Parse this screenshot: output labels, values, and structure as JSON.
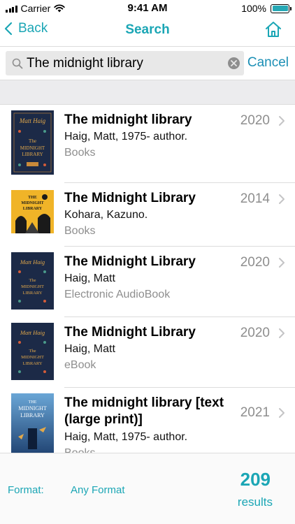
{
  "status_bar": {
    "carrier": "Carrier",
    "time": "9:41 AM",
    "battery": "100%"
  },
  "nav": {
    "back_label": "Back",
    "title": "Search"
  },
  "search": {
    "query": "The midnight library",
    "cancel_label": "Cancel"
  },
  "results": [
    {
      "title": "The midnight library",
      "author": "Haig, Matt, 1975- author.",
      "format": "Books",
      "year": "2020",
      "cover_caption": "Matt Haig"
    },
    {
      "title": "The Midnight Library",
      "author": "Kohara, Kazuno.",
      "format": "Books",
      "year": "2014",
      "cover_caption": "The Midnight Library"
    },
    {
      "title": "The Midnight Library",
      "author": "Haig, Matt",
      "format": "Electronic AudioBook",
      "year": "2020",
      "cover_caption": "Matt Haig"
    },
    {
      "title": "The Midnight Library",
      "author": "Haig, Matt",
      "format": "eBook",
      "year": "2020",
      "cover_caption": "Matt Haig"
    },
    {
      "title": "The midnight library [text (large print)]",
      "author": "Haig, Matt, 1975- author.",
      "format": "Books",
      "year": "2021",
      "cover_caption": "The Midnight Library"
    }
  ],
  "footer": {
    "format_label": "Format:",
    "format_value": "Any Format",
    "count": "209",
    "count_label": "results"
  },
  "colors": {
    "accent": "#1ba6b5",
    "cancel": "#1b8fb5",
    "secondary_text": "#8e8e8e"
  }
}
